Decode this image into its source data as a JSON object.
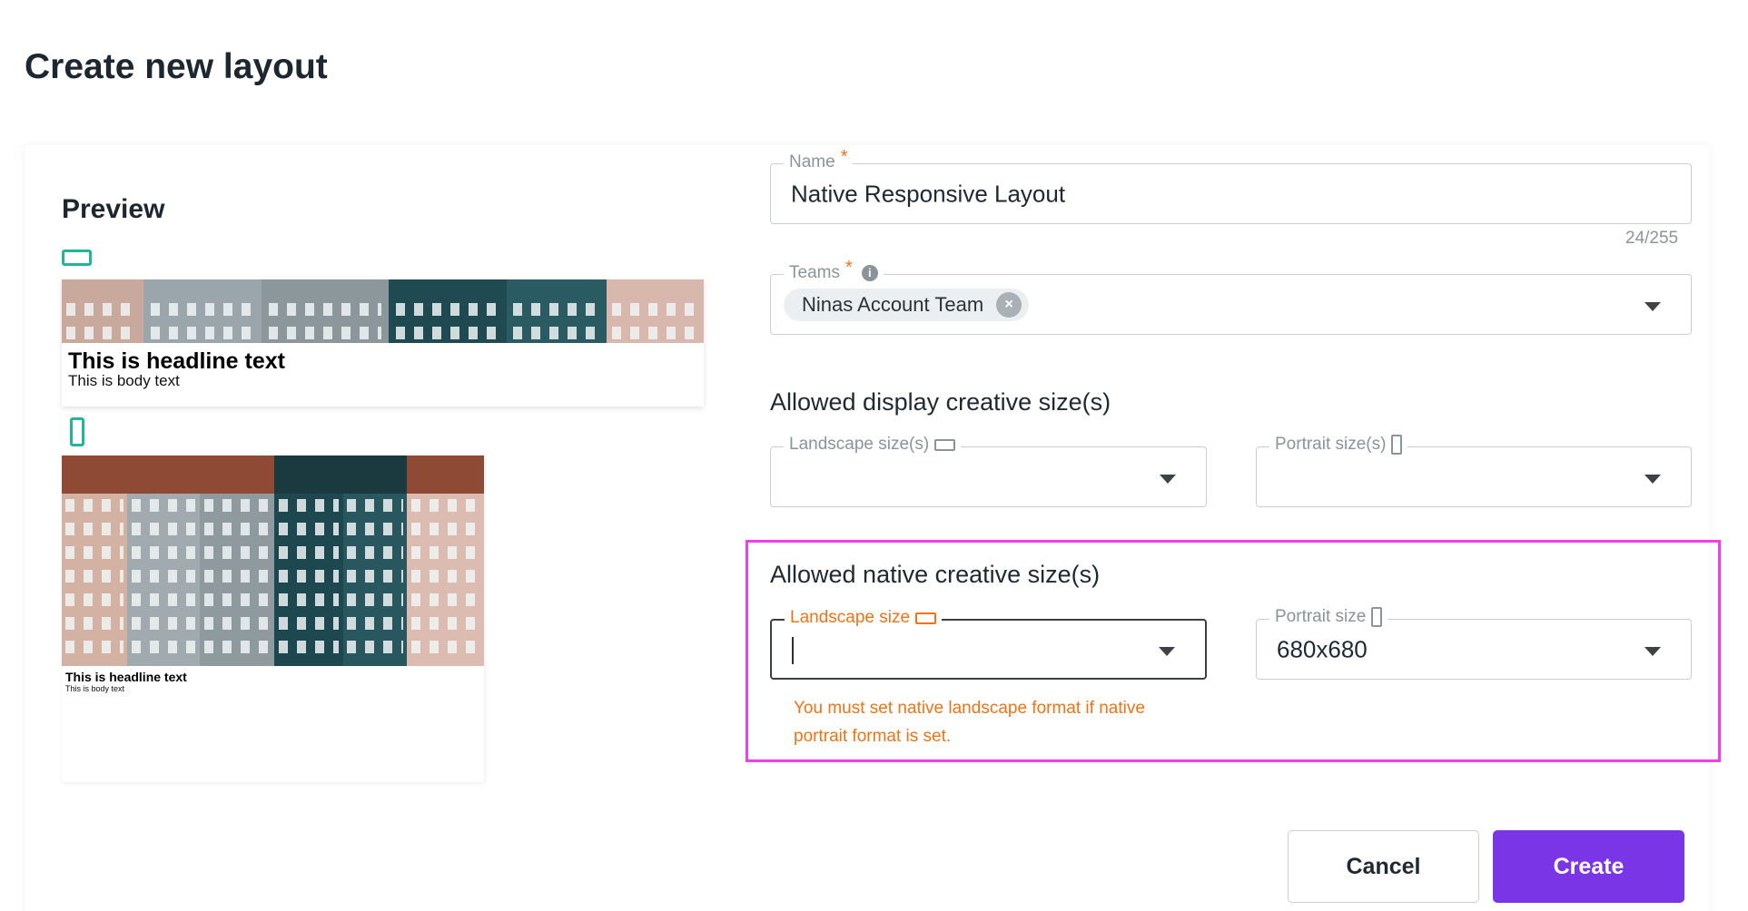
{
  "page": {
    "title": "Create new layout"
  },
  "preview": {
    "title": "Preview",
    "landscape_icon": "landscape-orientation-icon",
    "portrait_icon": "portrait-orientation-icon",
    "landscape": {
      "headline": "This is headline text",
      "body": "This is body text"
    },
    "portrait": {
      "headline": "This is headline text",
      "body": "This is body text"
    }
  },
  "form": {
    "name": {
      "label": "Name",
      "required_mark": "*",
      "value": "Native Responsive Layout",
      "counter": "24/255"
    },
    "teams": {
      "label": "Teams",
      "required_mark": "*",
      "info_icon": "info-icon",
      "info_glyph": "i",
      "chip": "Ninas Account Team",
      "chip_remove_glyph": "×"
    },
    "display_sizes": {
      "heading": "Allowed display creative size(s)",
      "landscape_label": "Landscape size(s)",
      "portrait_label": "Portrait size(s)"
    },
    "native_sizes": {
      "heading": "Allowed native creative size(s)",
      "landscape_label": "Landscape size",
      "landscape_value": "",
      "portrait_label": "Portrait size",
      "portrait_value": "680x680",
      "error": "You must set native landscape format if native portrait format is set."
    }
  },
  "actions": {
    "cancel": "Cancel",
    "create": "Create"
  },
  "colors": {
    "accent": "#7a36e6",
    "error": "#f07316",
    "highlight": "#f23df0",
    "preview_icon": "#22b59a"
  }
}
